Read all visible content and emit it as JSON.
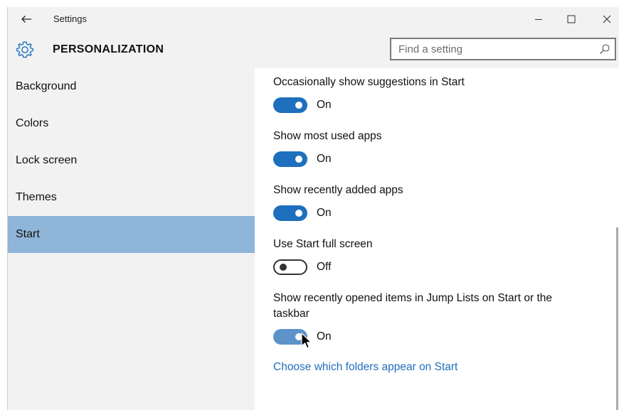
{
  "window": {
    "title": "Settings",
    "controls": {
      "minimize": "minimize",
      "maximize": "maximize",
      "close": "close"
    }
  },
  "header": {
    "section_title": "PERSONALIZATION",
    "icon": "gear-icon"
  },
  "search": {
    "placeholder": "Find a setting",
    "value": ""
  },
  "sidebar": {
    "items": [
      {
        "label": "Background",
        "selected": false
      },
      {
        "label": "Colors",
        "selected": false
      },
      {
        "label": "Lock screen",
        "selected": false
      },
      {
        "label": "Themes",
        "selected": false
      },
      {
        "label": "Start",
        "selected": true
      }
    ]
  },
  "settings": [
    {
      "label": "Occasionally show suggestions in Start",
      "state": "On"
    },
    {
      "label": "Show most used apps",
      "state": "On"
    },
    {
      "label": "Show recently added apps",
      "state": "On"
    },
    {
      "label": "Use Start full screen",
      "state": "Off"
    },
    {
      "label": "Show recently opened items in Jump Lists on Start or the taskbar",
      "state": "On"
    }
  ],
  "link": {
    "label": "Choose which folders appear on Start"
  },
  "colors": {
    "accent": "#1e6fbd",
    "selected_nav": "#8fb5d8",
    "chrome": "#f2f2f2"
  }
}
